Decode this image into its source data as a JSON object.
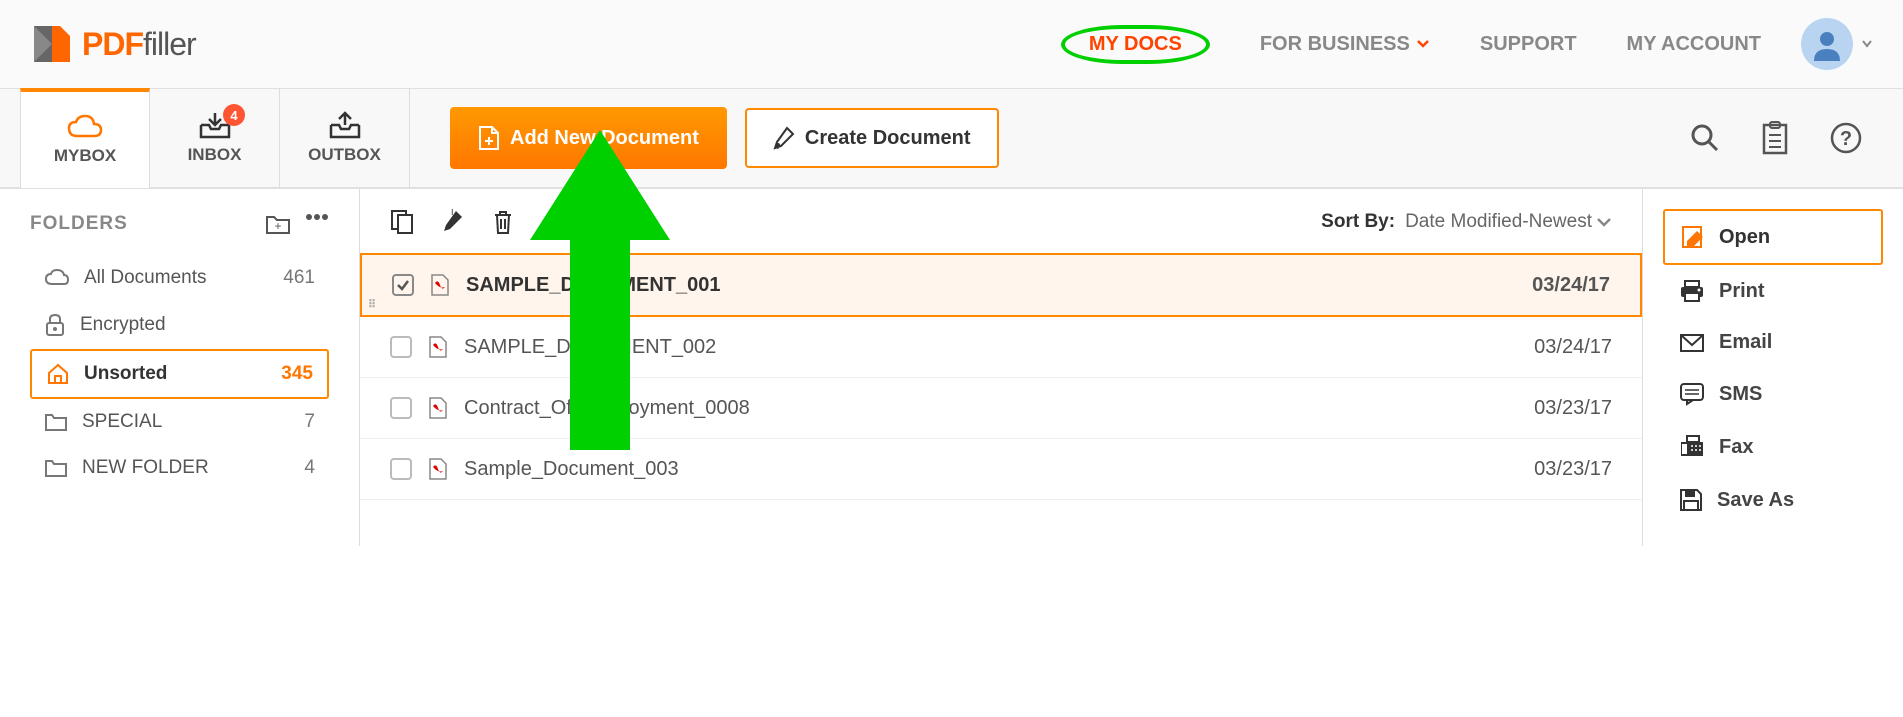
{
  "brand": {
    "pdf": "PDF",
    "filler": "filler"
  },
  "nav": {
    "mydocs": "MY DOCS",
    "business": "FOR BUSINESS",
    "support": "SUPPORT",
    "account": "MY ACCOUNT"
  },
  "tabs": {
    "mybox": "MYBOX",
    "inbox": "INBOX",
    "inbox_badge": "4",
    "outbox": "OUTBOX"
  },
  "buttons": {
    "add": "Add New Document",
    "create": "Create Document"
  },
  "folders": {
    "title": "FOLDERS",
    "items": [
      {
        "name": "All Documents",
        "count": "461"
      },
      {
        "name": "Encrypted",
        "count": ""
      },
      {
        "name": "Unsorted",
        "count": "345"
      },
      {
        "name": "SPECIAL",
        "count": "7"
      },
      {
        "name": "NEW FOLDER",
        "count": "4"
      }
    ]
  },
  "sort": {
    "label": "Sort By:",
    "value": "Date Modified-Newest"
  },
  "documents": [
    {
      "name": "SAMPLE_DOCUMENT_001",
      "date": "03/24/17"
    },
    {
      "name": "SAMPLE_DOCUMENT_002",
      "date": "03/24/17"
    },
    {
      "name": "Contract_Of_Employment_0008",
      "date": "03/23/17"
    },
    {
      "name": "Sample_Document_003",
      "date": "03/23/17"
    }
  ],
  "actions": {
    "open": "Open",
    "print": "Print",
    "email": "Email",
    "sms": "SMS",
    "fax": "Fax",
    "saveas": "Save As"
  }
}
